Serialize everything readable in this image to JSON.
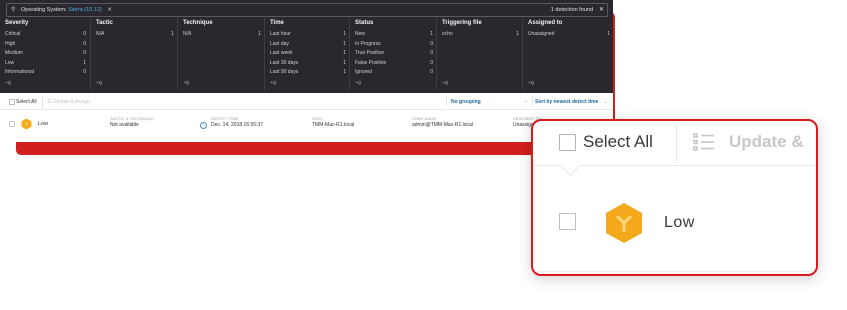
{
  "search": {
    "filter_label": "Operating System:",
    "filter_value": "Sierra (10.12)",
    "result_count": "1 detection found"
  },
  "filters": [
    {
      "title": "Severity",
      "rows": [
        {
          "label": "Critical",
          "count": "0"
        },
        {
          "label": "High",
          "count": "0"
        },
        {
          "label": "Medium",
          "count": "0"
        },
        {
          "label": "Low",
          "count": "1"
        },
        {
          "label": "Informational",
          "count": "0"
        }
      ]
    },
    {
      "title": "Tactic",
      "rows": [
        {
          "label": "N/A",
          "count": "1"
        }
      ]
    },
    {
      "title": "Technique",
      "rows": [
        {
          "label": "N/A",
          "count": "1"
        }
      ]
    },
    {
      "title": "Time",
      "rows": [
        {
          "label": "Last hour",
          "count": "1"
        },
        {
          "label": "Last day",
          "count": "1"
        },
        {
          "label": "Last week",
          "count": "1"
        },
        {
          "label": "Last 30 days",
          "count": "1"
        },
        {
          "label": "Last 90 days",
          "count": "1"
        }
      ]
    },
    {
      "title": "Status",
      "rows": [
        {
          "label": "New",
          "count": "1"
        },
        {
          "label": "In Progress",
          "count": "0"
        },
        {
          "label": "True Positive",
          "count": "0"
        },
        {
          "label": "False Positive",
          "count": "0"
        },
        {
          "label": "Ignored",
          "count": "0"
        }
      ]
    },
    {
      "title": "Triggering file",
      "rows": [
        {
          "label": "echo",
          "count": "1"
        }
      ]
    },
    {
      "title": "Assigned to",
      "rows": [
        {
          "label": "Unassigned",
          "count": "1"
        }
      ]
    }
  ],
  "add_filter_label": "+Q",
  "toolbar": {
    "select_all": "Select All",
    "update": "Update & Assign",
    "grouping": "No grouping",
    "sort": "Sort by newest detect time"
  },
  "detection": {
    "severity": "Low",
    "tactic_label": "TACTIC & TECHNIQUE",
    "tactic_value": "Not available",
    "time_label": "DETECT TIME",
    "time_value": "Dec. 14, 2018 16:55:37",
    "host_label": "HOST",
    "host_value": "TMM-Mac-R1.local",
    "user_label": "USER NAME",
    "user_value": "admin@TMM-Mac-R1.local",
    "assigned_label": "ASSIGNED TO",
    "assigned_value": "Unassign"
  },
  "zoom": {
    "select_all": "Select All",
    "update": "Update &",
    "severity": "Low"
  },
  "colors": {
    "dark_panel": "#2a282e",
    "accent_blue": "#4ab3e2",
    "highlight_red": "#d81c1f",
    "severity_low": "#f4a81c"
  }
}
